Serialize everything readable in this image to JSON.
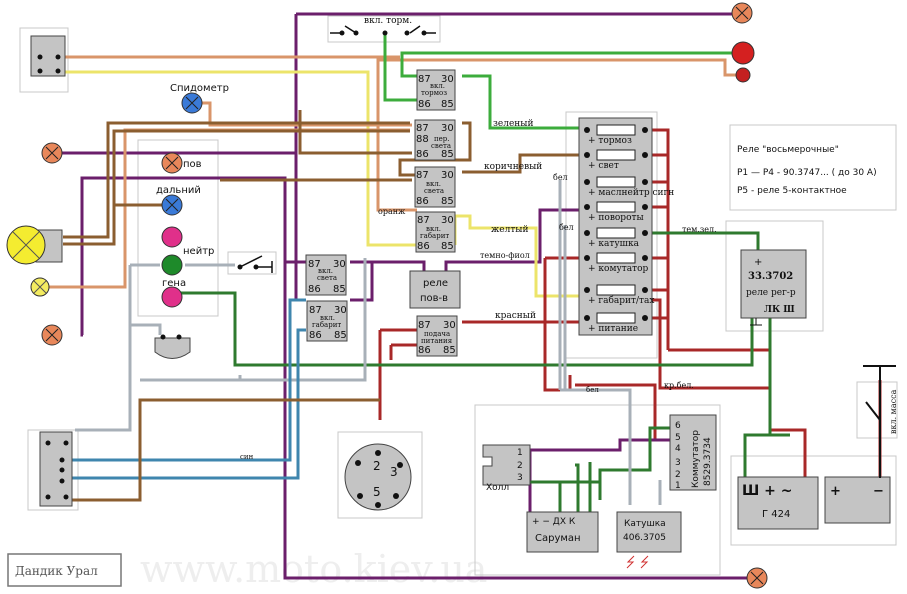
{
  "labels": {
    "speedometer": "Спидометр",
    "turn": "пов",
    "high_beam": "дальний",
    "neutral": "нейтр",
    "generator_lamp": "гена",
    "brake_switch": "вкл. торм.",
    "wire_green": "зеленый",
    "wire_brown": "коричневый",
    "wire_orange": "оранж",
    "wire_yellow": "желтый",
    "wire_dark_purple": "темно-фиол",
    "wire_red": "красный",
    "wire_white_1": "бел",
    "wire_white_2": "бел",
    "wire_white_3": "бел",
    "wire_red_white": "кр.бел.",
    "wire_dark_green": "тем.зел.",
    "wire_blue": "син",
    "mass_switch": "вкл. масса",
    "signature": "Дандик Урал",
    "watermark": "www.moto.kiev.ua"
  },
  "relays": {
    "brake": {
      "p87": "87",
      "p30": "30",
      "p86": "86",
      "p85": "85",
      "name1": "вкл.",
      "name2": "тормоз"
    },
    "beam": {
      "p87": "87",
      "p88": "88",
      "p30": "30",
      "p86": "86",
      "p85": "85",
      "name1": "пер.",
      "name2": "света"
    },
    "lights": {
      "p87": "87",
      "p30": "30",
      "p86": "86",
      "p85": "85",
      "name1": "вкл.",
      "name2": "света"
    },
    "parking": {
      "p87": "87",
      "p30": "30",
      "p86": "86",
      "p85": "85",
      "name1": "вкл.",
      "name2": "габарит"
    },
    "lights_left": {
      "p87": "87",
      "p30": "30",
      "p86": "86",
      "p85": "85",
      "name1": "вкл.",
      "name2": "света"
    },
    "parking_left": {
      "p87": "87",
      "p30": "30",
      "p86": "86",
      "p85": "85",
      "name1": "вкл.",
      "name2": "габарит"
    },
    "power": {
      "p87": "87",
      "p30": "30",
      "p86": "86",
      "p85": "85",
      "name1": "подача",
      "name2": "питания"
    },
    "turn": {
      "line1": "реле",
      "line2": "пов-в"
    }
  },
  "fuses": [
    {
      "label": "+ тормоз"
    },
    {
      "label": "+ свет"
    },
    {
      "label": "+ маслнейтр сигн"
    },
    {
      "label": "+ повороты"
    },
    {
      "label": "+ катушка"
    },
    {
      "label": "+ комутатор"
    },
    {
      "label": "+ габарит/тах"
    },
    {
      "label": "+ питание"
    }
  ],
  "notes": {
    "line1": "Реле  \"восьмерочные\"",
    "line2": "P1 — P4 -   90.3747... ( до 30 А)",
    "line3": "P5  - реле 5-контактное"
  },
  "regulator": {
    "plus": "+",
    "model": "33.3702",
    "name": "реле рег-р",
    "terminals": "ЛК Ш"
  },
  "ignition": {
    "hall": "Холл",
    "hall_pins": [
      "1",
      "2",
      "3"
    ],
    "saruman_pins": "+ −  ДХ  К",
    "saruman": "Саруман",
    "coil": "Катушка",
    "coil_model": "406.3705",
    "commutator": "Коммутатор",
    "commutator_model": "8529.3734",
    "commutator_pins": [
      "6",
      "5",
      "4",
      "3",
      "2",
      "1"
    ]
  },
  "generator": {
    "terminals": "Ш  +  ~",
    "model": "Г 424"
  },
  "battery": {
    "plus": "+",
    "minus": "−"
  },
  "connector": {
    "pins": [
      "2",
      "3",
      "5"
    ]
  },
  "colors": {
    "purple": "#6b1f6b",
    "brown": "#8b5e30",
    "tan": "#d9956a",
    "yellow": "#ece46a",
    "green": "#3cac3c",
    "dark_green": "#2f7a2f",
    "red": "#a82828",
    "gray": "#a8b0b8",
    "blue": "#3f86ae"
  }
}
